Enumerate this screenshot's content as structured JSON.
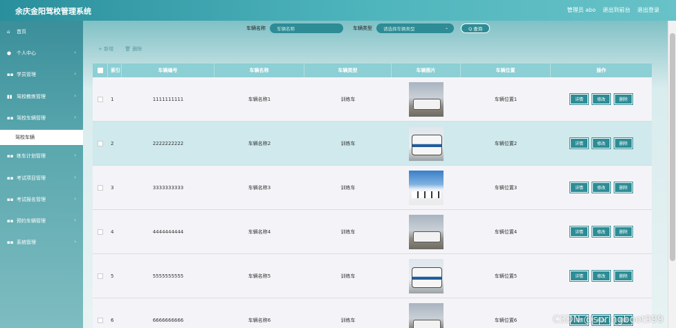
{
  "app": {
    "title": "余庆金阳驾校管理系统"
  },
  "topbar": {
    "user": "管理员 abo",
    "back_to_front": "退出到前台",
    "logout": "退出登录"
  },
  "sidebar": {
    "items": [
      {
        "label": "首页",
        "icon": "home-icon",
        "glyph": "⌂"
      },
      {
        "label": "个人中心",
        "icon": "user-icon",
        "glyph": "●"
      },
      {
        "label": "学员管理",
        "icon": "grid-icon",
        "glyph": "▪▪"
      },
      {
        "label": "驾校教练管理",
        "icon": "bar-chart-icon",
        "glyph": "▮▮"
      },
      {
        "label": "驾校车辆管理",
        "icon": "grid-icon",
        "glyph": "▪▪"
      },
      {
        "label": "练车计划管理",
        "icon": "grid-icon",
        "glyph": "▪▪"
      },
      {
        "label": "考试项目管理",
        "icon": "grid-icon",
        "glyph": "▪▪"
      },
      {
        "label": "考试报名管理",
        "icon": "grid-icon",
        "glyph": "▪▪"
      },
      {
        "label": "预约车辆管理",
        "icon": "grid-icon",
        "glyph": "▪▪"
      },
      {
        "label": "系统管理",
        "icon": "grid-icon",
        "glyph": "▪▪"
      }
    ],
    "active_sub": "驾校车辆"
  },
  "search": {
    "name_label": "车辆名称",
    "name_placeholder": "车辆名称",
    "type_label": "车辆类型",
    "type_placeholder": "请选择车辆类型",
    "button": "Q 查询"
  },
  "actions": {
    "add": "+ 新增",
    "delete": "🗑 删除"
  },
  "table": {
    "headers": [
      "索引",
      "车辆编号",
      "车辆名称",
      "车辆类型",
      "车辆图片",
      "车辆位置",
      "操作"
    ],
    "rows": [
      {
        "idx": "1",
        "no": "1111111111",
        "name": "车辆名称1",
        "type": "训练车",
        "loc": "车辆位置1",
        "img": "car"
      },
      {
        "idx": "2",
        "no": "2222222222",
        "name": "车辆名称2",
        "type": "训练车",
        "loc": "车辆位置2",
        "img": "bus"
      },
      {
        "idx": "3",
        "no": "3333333333",
        "name": "车辆名称3",
        "type": "训练车",
        "loc": "车辆位置3",
        "img": "fleet"
      },
      {
        "idx": "4",
        "no": "4444444444",
        "name": "车辆名称4",
        "type": "训练车",
        "loc": "车辆位置4",
        "img": "car"
      },
      {
        "idx": "5",
        "no": "5555555555",
        "name": "车辆名称5",
        "type": "训练车",
        "loc": "车辆位置5",
        "img": "bus"
      },
      {
        "idx": "6",
        "no": "6666666666",
        "name": "车辆名称6",
        "type": "训练车",
        "loc": "车辆位置6",
        "img": "car"
      }
    ],
    "op_labels": {
      "detail": "详情",
      "edit": "修改",
      "delete": "删除"
    }
  },
  "watermark": "CSDN @springboot999",
  "colors": {
    "accent": "#2d8c95",
    "header": "#8ccfd4",
    "highlight_row": "#cfe9ec"
  }
}
